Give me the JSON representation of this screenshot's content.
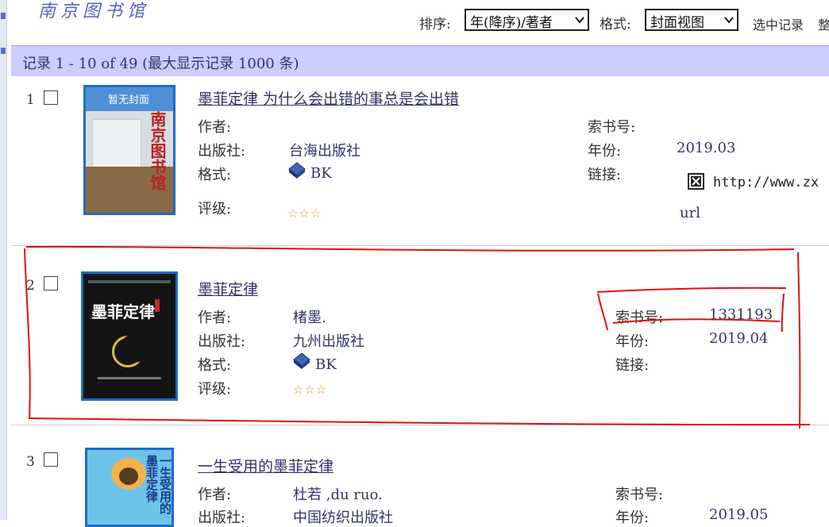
{
  "logo_text": "南京图书馆",
  "toolbar": {
    "sort_label": "排序:",
    "sort_value": "年(降序)/著者",
    "format_label": "格式:",
    "format_value": "封面视图",
    "selected_records": "选中记录",
    "overflow_text": "整"
  },
  "header": {
    "summary": "记录  1 - 10 of 49 (最大显示记录  1000 条)"
  },
  "labels": {
    "author": "作者:",
    "publisher": "出版社:",
    "format": "格式:",
    "rating": "评级:",
    "call_number": "索书号:",
    "year": "年份:",
    "link": "链接:"
  },
  "records": [
    {
      "number": "1",
      "title": "墨菲定律 为什么会出错的事总是会出错",
      "author": "",
      "publisher": "台海出版社",
      "format": "BK",
      "rating": "☆☆☆",
      "call_number": "",
      "year": "2019.03",
      "link_url": "http://www.zx",
      "link_type": "url",
      "cover_text": "暂无封面",
      "cover_logo": "南京图书馆"
    },
    {
      "number": "2",
      "title": "墨菲定律",
      "author": "楮墨.",
      "publisher": "九州出版社",
      "format": "BK",
      "rating": "☆☆☆",
      "call_number": "1331193",
      "year": "2019.04",
      "link_url": "",
      "cover_title": "墨菲定律"
    },
    {
      "number": "3",
      "title": "一生受用的墨菲定律",
      "author": "杜若 ,du ruo.",
      "publisher": "中国纺织出版社",
      "call_number": "",
      "year": "2019.05",
      "cover_title": "一生受用的墨菲定律"
    }
  ],
  "colors": {
    "header_band": "#ccccff",
    "link_text": "#333366",
    "cover_border": "#1f6cc4",
    "annotation": "#dd1111"
  }
}
